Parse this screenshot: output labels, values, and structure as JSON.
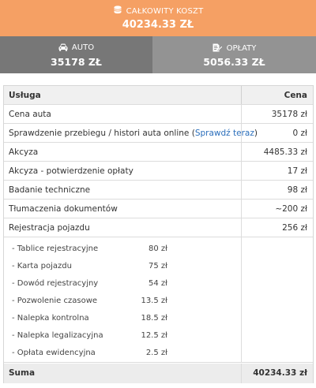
{
  "total": {
    "label": "CAŁKOWITY KOSZT",
    "value": "40234.33 ZŁ",
    "icon": "money-icon",
    "bg": "#f5a064"
  },
  "auto": {
    "label": "AUTO",
    "value": "35178 ZŁ",
    "icon": "car-icon",
    "bg": "#777777"
  },
  "fees": {
    "label": "OPŁATY",
    "value": "5056.33 ZŁ",
    "icon": "document-edit-icon",
    "bg": "#939393"
  },
  "table": {
    "header": {
      "service": "Usługa",
      "price": "Cena"
    },
    "rows": [
      {
        "service": "Cena auta",
        "price": "35178 zł"
      },
      {
        "service": "Sprawdzenie przebiegu / histori auta online",
        "link_open": " (",
        "link": "Sprawdź teraz",
        "link_close": ")",
        "price": "0 zł"
      },
      {
        "service": "Akcyza",
        "price": "4485.33 zł"
      },
      {
        "service": "Akcyza - potwierdzenie opłaty",
        "price": "17 zł"
      },
      {
        "service": "Badanie techniczne",
        "price": "98 zł"
      },
      {
        "service": "Tłumaczenia dokumentów",
        "price": "~200 zł"
      },
      {
        "service": "Rejestracja pojazdu",
        "price": "256 zł"
      }
    ],
    "registration_items": [
      {
        "name": "- Tablice rejestracyjne",
        "price": "80 zł"
      },
      {
        "name": "- Karta pojazdu",
        "price": "75 zł"
      },
      {
        "name": "- Dowód rejestracyjny",
        "price": "54 zł"
      },
      {
        "name": "- Pozwolenie czasowe",
        "price": "13.5 zł"
      },
      {
        "name": "- Nalepka kontrolna",
        "price": "18.5 zł"
      },
      {
        "name": "- Nalepka legalizacyjna",
        "price": "12.5 zł"
      },
      {
        "name": "- Opłata ewidencyjna",
        "price": "2.5 zł"
      }
    ],
    "sum": {
      "label": "Suma",
      "price": "40234.33 zł"
    }
  }
}
